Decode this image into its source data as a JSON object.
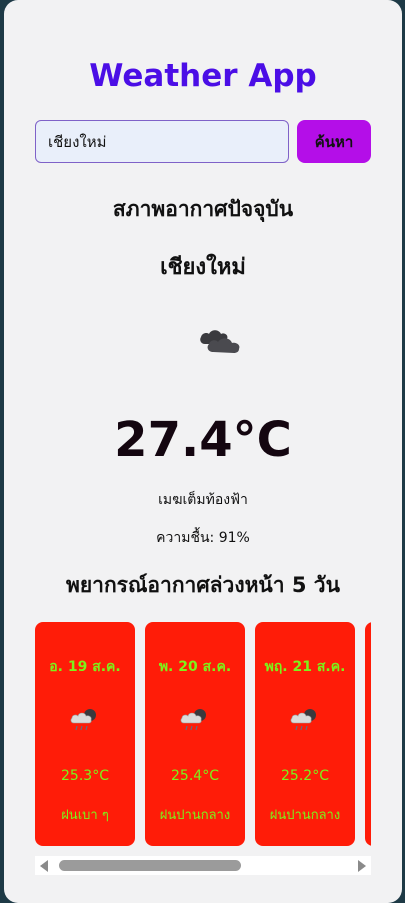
{
  "app": {
    "title": "Weather App"
  },
  "search": {
    "value": "เชียงใหม่",
    "button_label": "ค้นหา"
  },
  "current": {
    "section_title": "สภาพอากาศปัจจุบัน",
    "city": "เชียงใหม่",
    "icon": "broken-clouds-icon",
    "temperature": "27.4°C",
    "description": "เมฆเต็มท้องฟ้า",
    "humidity": "ความชื้น: 91%"
  },
  "forecast": {
    "section_title": "พยากรณ์อากาศล่วงหน้า 5 วัน",
    "days": [
      {
        "date": "อ. 19 ส.ค.",
        "icon": "rain-cloud-icon",
        "temp": "25.3°C",
        "desc": "ฝนเบา ๆ"
      },
      {
        "date": "พ. 20 ส.ค.",
        "icon": "rain-cloud-icon",
        "temp": "25.4°C",
        "desc": "ฝนปานกลาง"
      },
      {
        "date": "พฤ. 21 ส.ค.",
        "icon": "rain-cloud-icon",
        "temp": "25.2°C",
        "desc": "ฝนปานกลาง"
      }
    ]
  },
  "colors": {
    "background": "#1e3a46",
    "card": "#f2f2f3",
    "title": "#4b0ee6",
    "button": "#b40ee8",
    "forecast_card": "#ff1c08",
    "forecast_text": "#7df21a"
  }
}
